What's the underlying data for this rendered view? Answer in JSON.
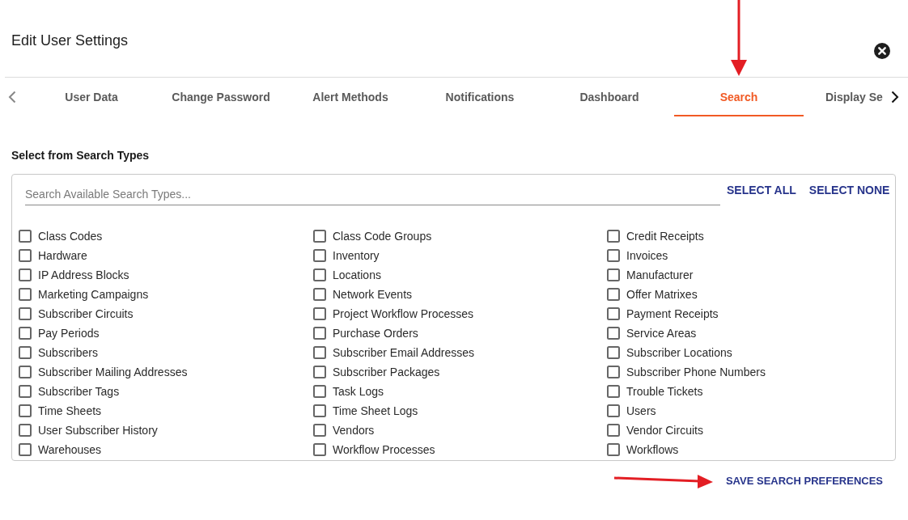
{
  "dialog": {
    "title": "Edit User Settings"
  },
  "tab_scroll": {
    "back_enabled": false,
    "forward_enabled": true
  },
  "tabs": [
    {
      "label": "User Data",
      "selected": false,
      "arrow_marked": false
    },
    {
      "label": "Change Password",
      "selected": false,
      "arrow_marked": false
    },
    {
      "label": "Alert Methods",
      "selected": false,
      "arrow_marked": false
    },
    {
      "label": "Notifications",
      "selected": false,
      "arrow_marked": false
    },
    {
      "label": "Dashboard",
      "selected": false,
      "arrow_marked": false
    },
    {
      "label": "Search",
      "selected": true,
      "arrow_marked": true
    },
    {
      "label": "Display Se",
      "selected": false,
      "arrow_marked": false
    }
  ],
  "section": {
    "heading": "Select from Search Types"
  },
  "search_types": {
    "search": {
      "placeholder": "Search Available Search Types..."
    },
    "actions": [
      "SELECT ALL",
      "SELECT NONE"
    ],
    "options": [
      {
        "label": "Class Codes",
        "checked": false
      },
      {
        "label": "Class Code Groups",
        "checked": false
      },
      {
        "label": "Credit Receipts",
        "checked": false
      },
      {
        "label": "Hardware",
        "checked": false
      },
      {
        "label": "Inventory",
        "checked": false
      },
      {
        "label": "Invoices",
        "checked": false
      },
      {
        "label": "IP Address Blocks",
        "checked": false
      },
      {
        "label": "Locations",
        "checked": false
      },
      {
        "label": "Manufacturer",
        "checked": false
      },
      {
        "label": "Marketing Campaigns",
        "checked": false
      },
      {
        "label": "Network Events",
        "checked": false
      },
      {
        "label": "Offer Matrixes",
        "checked": false
      },
      {
        "label": "Subscriber Circuits",
        "checked": false
      },
      {
        "label": "Project Workflow Processes",
        "checked": false
      },
      {
        "label": "Payment Receipts",
        "checked": false
      },
      {
        "label": "Pay Periods",
        "checked": false
      },
      {
        "label": "Purchase Orders",
        "checked": false
      },
      {
        "label": "Service Areas",
        "checked": false
      },
      {
        "label": "Subscribers",
        "checked": false
      },
      {
        "label": "Subscriber Email Addresses",
        "checked": false
      },
      {
        "label": "Subscriber Locations",
        "checked": false
      },
      {
        "label": "Subscriber Mailing Addresses",
        "checked": false
      },
      {
        "label": "Subscriber Packages",
        "checked": false
      },
      {
        "label": "Subscriber Phone Numbers",
        "checked": false
      },
      {
        "label": "Subscriber Tags",
        "checked": false
      },
      {
        "label": "Task Logs",
        "checked": false
      },
      {
        "label": "Trouble Tickets",
        "checked": false
      },
      {
        "label": "Time Sheets",
        "checked": false
      },
      {
        "label": "Time Sheet Logs",
        "checked": false
      },
      {
        "label": "Users",
        "checked": false
      },
      {
        "label": "User Subscriber History",
        "checked": false
      },
      {
        "label": "Vendors",
        "checked": false
      },
      {
        "label": "Vendor Circuits",
        "checked": false
      },
      {
        "label": "Warehouses",
        "checked": false
      },
      {
        "label": "Workflow Processes",
        "checked": false
      },
      {
        "label": "Workflows",
        "checked": false
      }
    ]
  },
  "save_button": {
    "label": "SAVE SEARCH PREFERENCES",
    "arrow_marked": true
  }
}
